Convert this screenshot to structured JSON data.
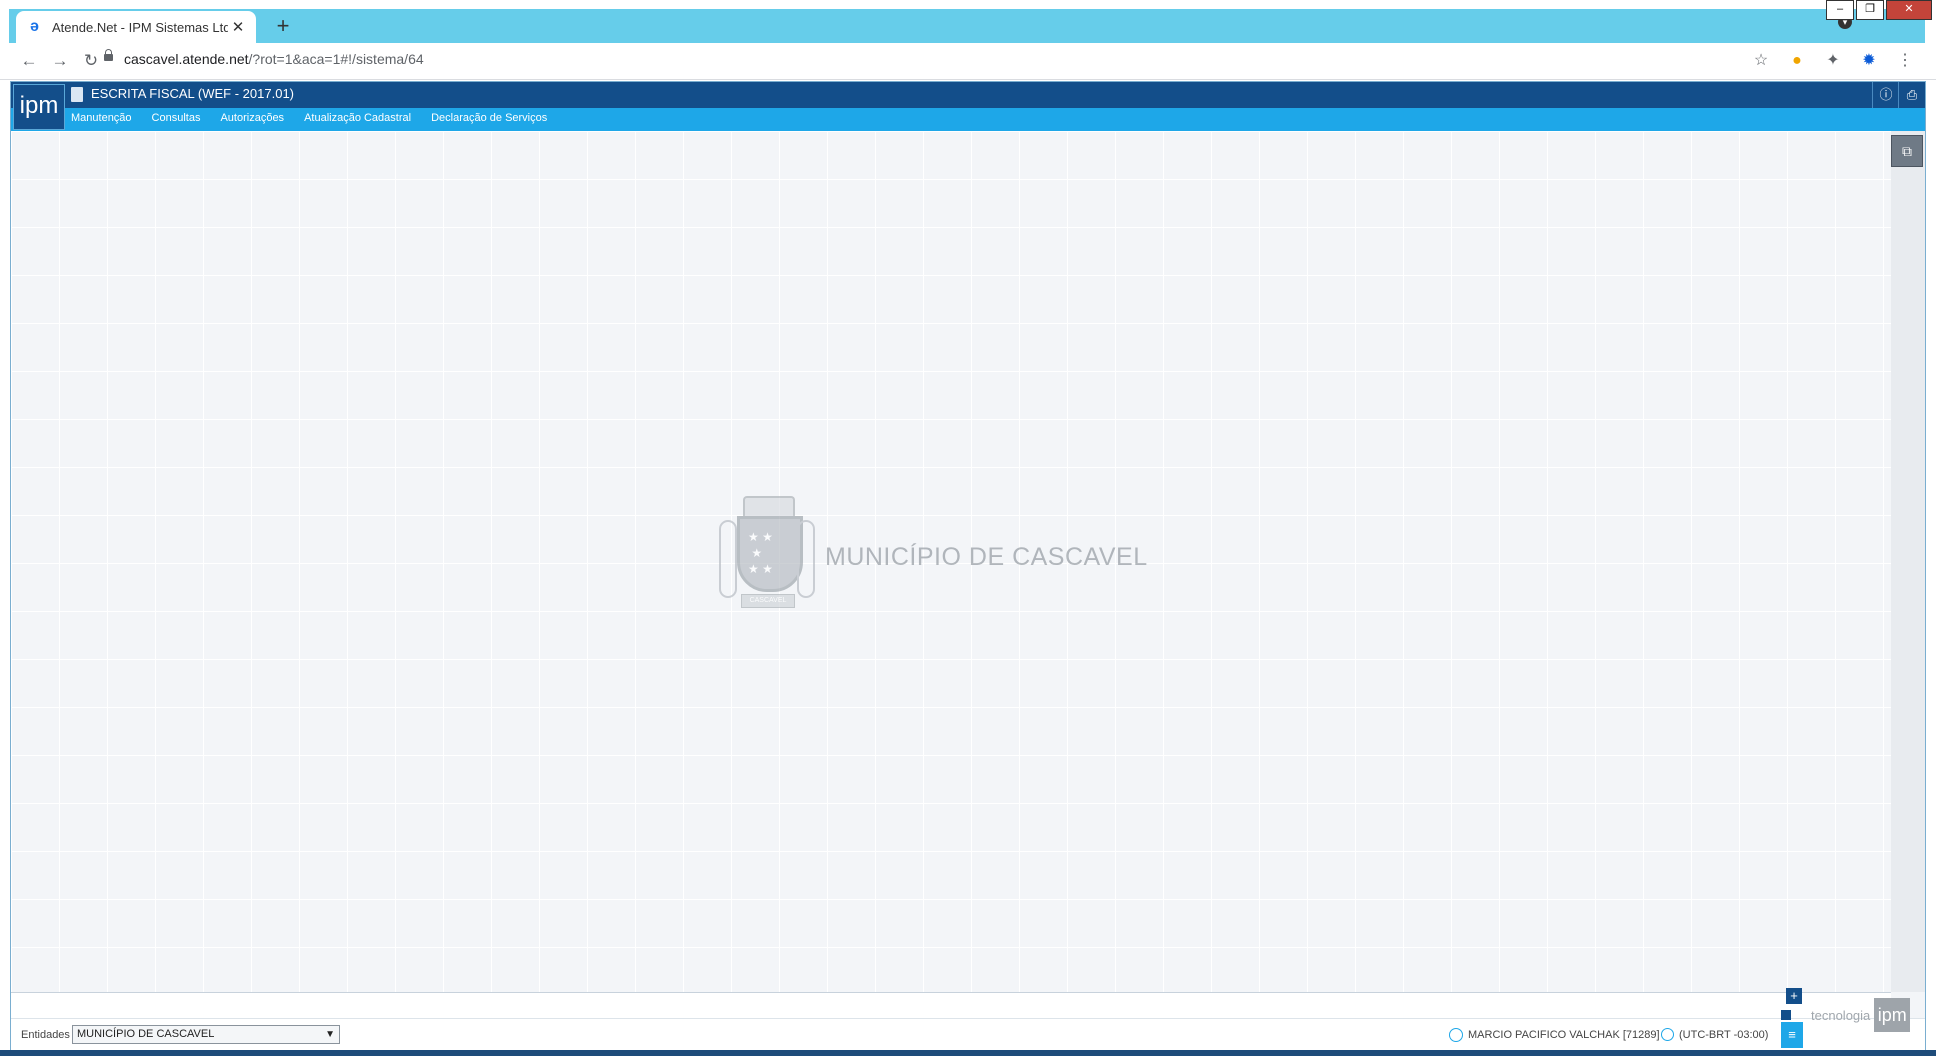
{
  "browser": {
    "tab_title": "Atende.Net - IPM Sistemas Ltda",
    "tab_close": "✕",
    "new_tab": "+",
    "url_host": "cascavel.atende.net",
    "url_path": "/?rot=1&aca=1#!/sistema/64",
    "window": {
      "minimize": "–",
      "restore": "❐",
      "close": "✕"
    }
  },
  "app": {
    "logo_text": "ipm",
    "title": "ESCRITA FISCAL (WEF - 2017.01)",
    "menu": [
      "Manutenção",
      "Consultas",
      "Autorizações",
      "Atualização Cadastral",
      "Declaração de Serviços"
    ],
    "info_btn": "ⓘ",
    "print_btn": "⎙"
  },
  "watermark": {
    "text": "MUNICÍPIO DE CASCAVEL",
    "ribbon": "CASCAVEL"
  },
  "status": {
    "entities_label": "Entidades",
    "entity_selected": "MUNICÍPIO DE CASCAVEL",
    "user": "MARCIO PACIFICO VALCHAK [71289]",
    "timezone": "(UTC-BRT -03:00)",
    "brand_text": "tecnologia",
    "brand_logo": "ipm"
  },
  "colors": {
    "header": "#134e8a",
    "menu": "#1ea7e8",
    "tabstrip": "#66cdea"
  }
}
